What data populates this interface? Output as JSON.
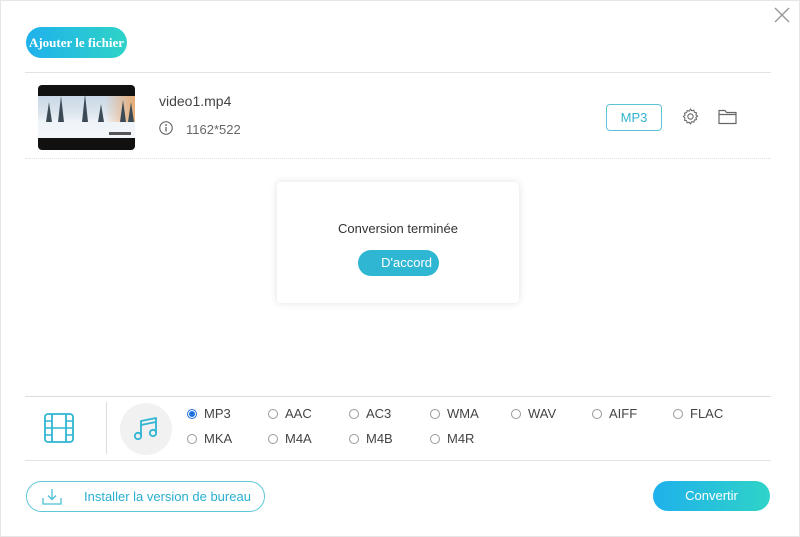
{
  "window": {
    "close_icon": "close-icon"
  },
  "toolbar": {
    "add_file_label": "Ajouter le fichier"
  },
  "file": {
    "name": "video1.mp4",
    "resolution": "1162*522",
    "output_format": "MP3"
  },
  "dialog": {
    "message": "Conversion terminée",
    "ok_label": "D'accord"
  },
  "formats": {
    "selected": "MP3",
    "row1": [
      "MP3",
      "AAC",
      "AC3",
      "WMA",
      "WAV",
      "AIFF",
      "FLAC"
    ],
    "row2": [
      "MKA",
      "M4A",
      "M4B",
      "M4R"
    ]
  },
  "footer": {
    "install_label": "Installer la version de bureau",
    "convert_label": "Convertir"
  },
  "colors": {
    "accent": "#2fb6d3",
    "gradient_start": "#1fb1ec",
    "gradient_end": "#2fd3c7",
    "radio_selected": "#1d6fe3"
  }
}
